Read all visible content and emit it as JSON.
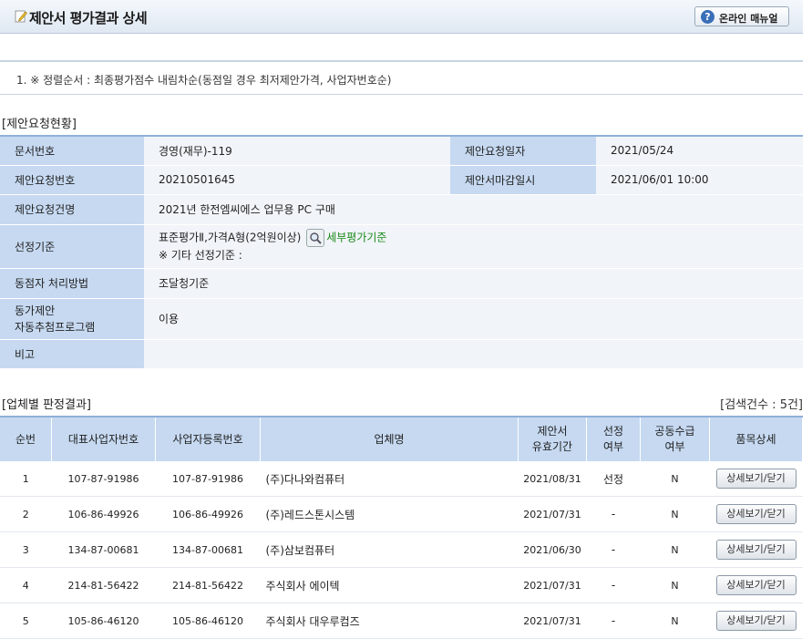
{
  "header": {
    "title": "제안서 평가결과 상세",
    "manual_label": "온라인 매뉴얼"
  },
  "notice": "1. ※ 정렬순서 : 최종평가점수 내림차순(동점일 경우 최저제안가격, 사업자번호순)",
  "request_section": {
    "title": "[제안요청현황]",
    "doc_no_label": "문서번호",
    "doc_no": "경영(재무)-119",
    "req_date_label": "제안요청일자",
    "req_date": "2021/05/24",
    "req_no_label": "제안요청번호",
    "req_no": "20210501645",
    "deadline_label": "제안서마감일시",
    "deadline": "2021/06/01 10:00",
    "req_name_label": "제안요청건명",
    "req_name": "2021년 한전엠씨에스 업무용 PC 구매",
    "criteria_label": "선정기준",
    "criteria": "표준평가Ⅱ,가격A형(2억원이상)",
    "criteria_link": "세부평가기준",
    "criteria_other": "※ 기타 선정기준 :",
    "tie_label": "동점자 처리방법",
    "tie": "조달청기준",
    "auto_label_1": "동가제안",
    "auto_label_2": "자동추첨프로그램",
    "auto": "이용",
    "note_label": "비고",
    "note": ""
  },
  "result_section": {
    "title": "[업체별 판정결과]",
    "count": "[검색건수 : 5건]",
    "columns": {
      "seq": "순번",
      "rep_no": "대표사업자번호",
      "biz_no": "사업자등록번호",
      "company": "업체명",
      "valid_1": "제안서",
      "valid_2": "유효기간",
      "selected_1": "선정",
      "selected_2": "여부",
      "joint_1": "공동수급",
      "joint_2": "여부",
      "detail": "품목상세"
    },
    "rows": [
      {
        "seq": "1",
        "rep_no": "107-87-91986",
        "biz_no": "107-87-91986",
        "company": "(주)다나와컴퓨터",
        "valid": "2021/08/31",
        "selected": "선정",
        "joint": "N",
        "btn": "상세보기/닫기"
      },
      {
        "seq": "2",
        "rep_no": "106-86-49926",
        "biz_no": "106-86-49926",
        "company": "(주)레드스톤시스템",
        "valid": "2021/07/31",
        "selected": "-",
        "joint": "N",
        "btn": "상세보기/닫기"
      },
      {
        "seq": "3",
        "rep_no": "134-87-00681",
        "biz_no": "134-87-00681",
        "company": "(주)삼보컴퓨터",
        "valid": "2021/06/30",
        "selected": "-",
        "joint": "N",
        "btn": "상세보기/닫기"
      },
      {
        "seq": "4",
        "rep_no": "214-81-56422",
        "biz_no": "214-81-56422",
        "company": "주식회사 에이텍",
        "valid": "2021/07/31",
        "selected": "-",
        "joint": "N",
        "btn": "상세보기/닫기"
      },
      {
        "seq": "5",
        "rep_no": "105-86-46120",
        "biz_no": "105-86-46120",
        "company": "주식회사 대우루컴즈",
        "valid": "2021/07/31",
        "selected": "-",
        "joint": "N",
        "btn": "상세보기/닫기"
      }
    ]
  }
}
